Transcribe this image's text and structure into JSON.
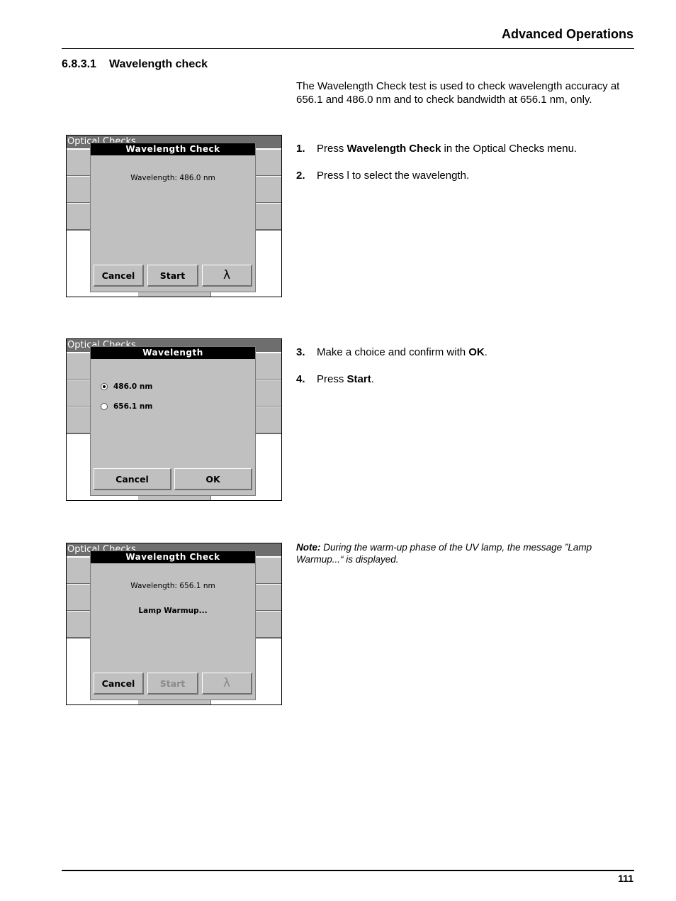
{
  "header": {
    "title": "Advanced Operations"
  },
  "section": {
    "number": "6.8.3.1",
    "title": "Wavelength check"
  },
  "intro": "The Wavelength Check test is used to check wavelength accuracy at 656.1 and 486.0 nm and to check bandwidth at 656.1 nm, only.",
  "steps_group1": [
    {
      "num": "1.",
      "pre": "Press ",
      "bold": "Wavelength Check",
      "post": " in the Optical Checks menu."
    },
    {
      "num": "2.",
      "pre": "Press l to select the wavelength.",
      "bold": "",
      "post": ""
    }
  ],
  "steps_group2": [
    {
      "num": "3.",
      "pre": "Make a choice and confirm with ",
      "bold": "OK",
      "post": "."
    },
    {
      "num": "4.",
      "pre": "Press ",
      "bold": "Start",
      "post": "."
    }
  ],
  "note": {
    "label": "Note:",
    "text": " During the warm-up phase of the UV lamp, the message ”Lamp Warmup...“ is displayed."
  },
  "screens": [
    {
      "menu_title": "Optical Checks",
      "dialog_title": "Wavelength Check",
      "wavelength_line": "Wavelength: 486.0 nm",
      "buttons": {
        "cancel": "Cancel",
        "start": "Start",
        "lambda": "λ"
      }
    },
    {
      "menu_title": "Optical Checks",
      "dialog_title": "Wavelength",
      "options": [
        {
          "label": "486.0 nm",
          "selected": true
        },
        {
          "label": "656.1 nm",
          "selected": false
        }
      ],
      "buttons": {
        "cancel": "Cancel",
        "ok": "OK"
      }
    },
    {
      "menu_title": "Optical Checks",
      "dialog_title": "Wavelength Check",
      "wavelength_line": "Wavelength: 656.1 nm",
      "status": "Lamp Warmup...",
      "buttons": {
        "cancel": "Cancel",
        "start": "Start",
        "lambda": "λ",
        "start_disabled": true,
        "lambda_disabled": true
      }
    }
  ],
  "footer": {
    "page_number": "111"
  }
}
